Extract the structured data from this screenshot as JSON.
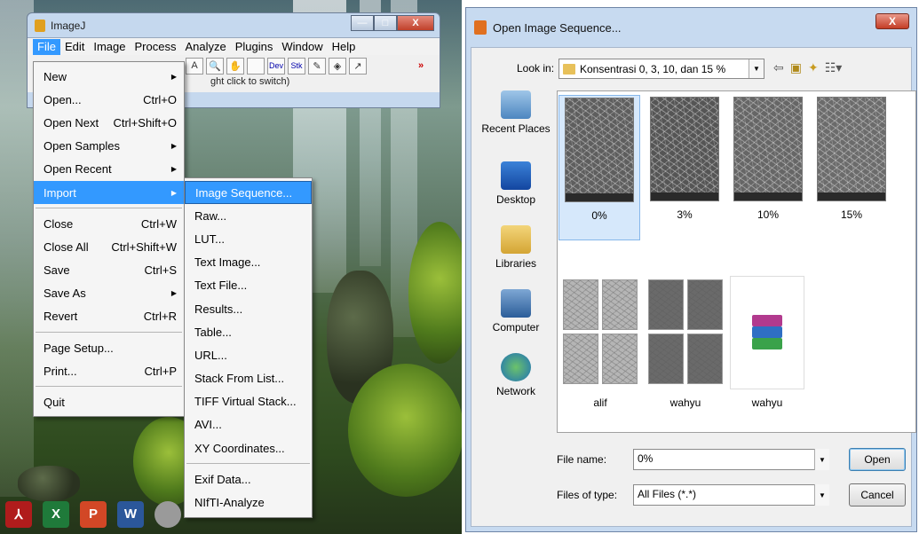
{
  "imagej": {
    "title": "ImageJ",
    "menubar": [
      "File",
      "Edit",
      "Image",
      "Process",
      "Analyze",
      "Plugins",
      "Window",
      "Help"
    ],
    "toolbar": [
      "A",
      "🔍",
      "✋",
      "",
      "Dev",
      "Stk",
      "",
      "",
      "",
      "»"
    ],
    "status": "ght click to switch)"
  },
  "file_menu": {
    "items": [
      {
        "label": "New",
        "shortcut": "",
        "submenu": true
      },
      {
        "label": "Open...",
        "shortcut": "Ctrl+O"
      },
      {
        "label": "Open Next",
        "shortcut": "Ctrl+Shift+O"
      },
      {
        "label": "Open Samples",
        "shortcut": "",
        "submenu": true
      },
      {
        "label": "Open Recent",
        "shortcut": "",
        "submenu": true
      },
      {
        "label": "Import",
        "shortcut": "",
        "submenu": true,
        "highlighted": true
      },
      {
        "label": "Close",
        "shortcut": "Ctrl+W"
      },
      {
        "label": "Close All",
        "shortcut": "Ctrl+Shift+W"
      },
      {
        "label": "Save",
        "shortcut": "Ctrl+S"
      },
      {
        "label": "Save As",
        "shortcut": "",
        "submenu": true
      },
      {
        "label": "Revert",
        "shortcut": "Ctrl+R"
      },
      {
        "label": "Page Setup...",
        "shortcut": ""
      },
      {
        "label": "Print...",
        "shortcut": "Ctrl+P"
      },
      {
        "label": "Quit",
        "shortcut": ""
      }
    ]
  },
  "import_menu": {
    "items": [
      "Image Sequence...",
      "Raw...",
      "LUT...",
      "Text Image...",
      "Text File...",
      "Results...",
      "Table...",
      "URL...",
      "Stack From List...",
      "TIFF Virtual Stack...",
      "AVI...",
      "XY Coordinates...",
      "Exif Data...",
      "NIfTI-Analyze"
    ]
  },
  "taskbar": {
    "icons": [
      "acrobat-icon",
      "excel-icon",
      "powerpoint-icon",
      "word-icon",
      "imagej-icon"
    ],
    "glyphs": [
      "⅄",
      "X",
      "P",
      "W",
      ""
    ],
    "colors": [
      "#b01c1c",
      "#1f7a3a",
      "#d24726",
      "#2b579a",
      "#9a9a9a"
    ]
  },
  "dialog": {
    "title": "Open Image Sequence...",
    "look_in_label": "Look in:",
    "look_in_value": "Konsentrasi 0, 3, 10, dan 15 %",
    "places": [
      "Recent Places",
      "Desktop",
      "Libraries",
      "Computer",
      "Network"
    ],
    "files": [
      {
        "name": "0%",
        "selected": true
      },
      {
        "name": "3%"
      },
      {
        "name": "10%"
      },
      {
        "name": "15%"
      },
      {
        "name": "alif"
      },
      {
        "name": "wahyu"
      },
      {
        "name": "wahyu"
      }
    ],
    "file_name_label": "File name:",
    "file_name_value": "0%",
    "file_type_label": "Files of type:",
    "file_type_value": "All Files (*.*)",
    "open_label": "Open",
    "cancel_label": "Cancel"
  }
}
